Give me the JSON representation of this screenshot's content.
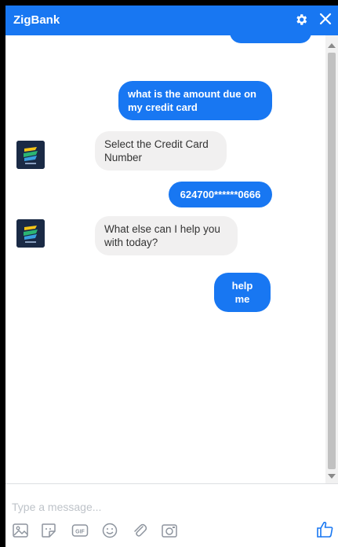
{
  "header": {
    "title": "ZigBank",
    "color": "#1877f2"
  },
  "messages": [
    {
      "role": "user",
      "text": "what is the amount due on my credit card"
    },
    {
      "role": "bot",
      "text": "Select the Credit Card Number"
    },
    {
      "role": "user",
      "text": "624700******0666"
    },
    {
      "role": "bot",
      "text": "What else can I help you with today?"
    },
    {
      "role": "user",
      "text": "help me"
    }
  ],
  "composer": {
    "placeholder": "Type a message...",
    "tools": [
      "image-icon",
      "sticker-icon",
      "gif-icon",
      "emoji-icon",
      "attachment-icon",
      "camera-icon"
    ],
    "send": "like-icon"
  }
}
